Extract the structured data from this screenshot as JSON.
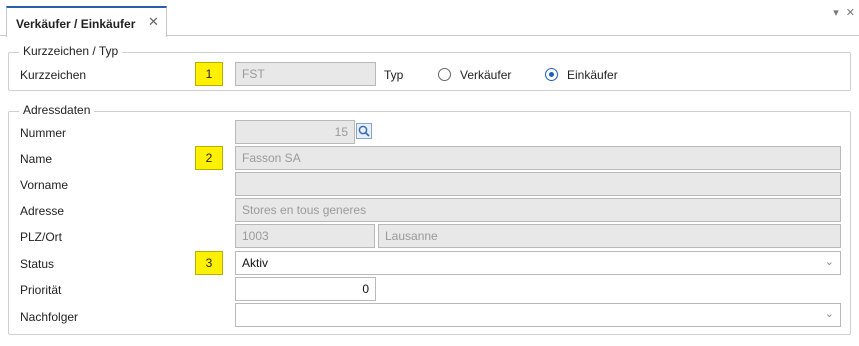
{
  "tab": {
    "label": "Verkäufer / Einkäufer",
    "close": "✕"
  },
  "window_controls": {
    "pin": "▾",
    "close": "✕"
  },
  "group_kurz": {
    "title": "Kurzzeichen / Typ",
    "kurzzeichen_label": "Kurzzeichen",
    "kurzzeichen_value": "FST",
    "typ_label": "Typ",
    "radio_verkaeufer": "Verkäufer",
    "radio_einkaeufer": "Einkäufer",
    "selected": "Einkäufer"
  },
  "group_adresse": {
    "title": "Adressdaten",
    "nummer_label": "Nummer",
    "nummer_value": "15",
    "name_label": "Name",
    "name_value": "Fasson SA",
    "vorname_label": "Vorname",
    "vorname_value": "",
    "adresse_label": "Adresse",
    "adresse_value": "Stores en tous generes",
    "plzort_label": "PLZ/Ort",
    "plz_value": "1003",
    "ort_value": "Lausanne",
    "status_label": "Status",
    "status_value": "Aktiv",
    "prioritaet_label": "Priorität",
    "prioritaet_value": "0",
    "nachfolger_label": "Nachfolger",
    "nachfolger_value": ""
  },
  "markers": {
    "m1": "1",
    "m2": "2",
    "m3": "3"
  },
  "colors": {
    "marker": "#fdf000",
    "tab_accent": "#2b5ea8",
    "readonly_bg": "#e8e8e8"
  }
}
